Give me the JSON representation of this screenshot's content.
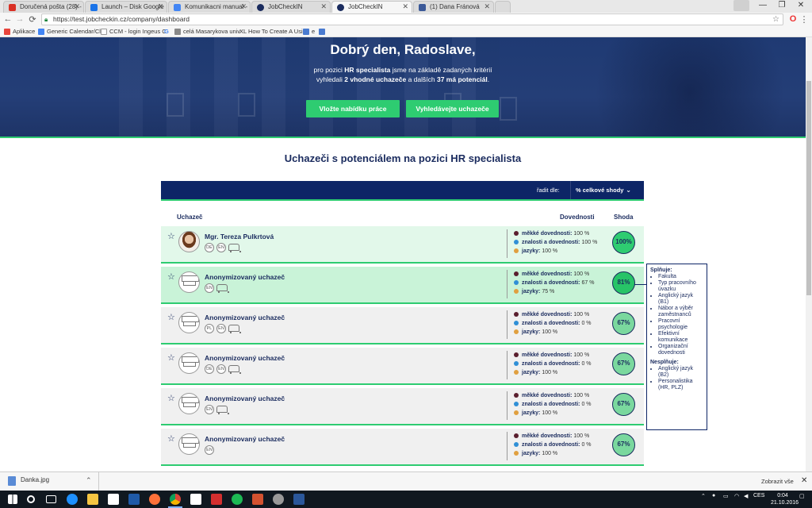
{
  "browser": {
    "tabs": [
      {
        "label": "Doručená pošta (28) - r…",
        "color": "#d93025"
      },
      {
        "label": "Launch – Disk Google",
        "color": "#1a73e8"
      },
      {
        "label": "Komunikacni manual - D…",
        "color": "#4285f4"
      },
      {
        "label": "JobCheckIN",
        "color": "#1a2b5e"
      },
      {
        "label": "JobCheckIN",
        "color": "#1a2b5e"
      },
      {
        "label": "(1) Dana Fránová",
        "color": "#3b5998"
      }
    ],
    "url": "https://test.jobcheckin.cz/company/dashboard",
    "bookmarks": [
      {
        "label": "Aplikace",
        "color": "#e8453c"
      },
      {
        "label": "Generic Calendar/Clo",
        "color": "#4285f4"
      },
      {
        "label": "CCM - login Ingeus C",
        "color": "#555555"
      },
      {
        "label": "G",
        "color": "#4285f4"
      },
      {
        "label": "celá Masarykova univ",
        "color": "#888888"
      },
      {
        "label": "XL How To Create A Usi",
        "color": "#c0392b"
      },
      {
        "label": "e",
        "color": "#4a7bd0"
      },
      {
        "label": "",
        "color": "#4a7bd0"
      }
    ]
  },
  "hero": {
    "greeting": "Dobrý den, Radoslave,",
    "sub1_pre": "pro pozici ",
    "sub1_bold": "HR specialista",
    "sub1_post": " jsme na základě zadaných kritérií",
    "sub2_pre": "vyhledali ",
    "sub2_bold1": "2 vhodné uchazeče",
    "sub2_mid": " a dalších ",
    "sub2_bold2": "37 má potenciál",
    "sub2_post": ".",
    "btn_offer": "Vložte nabídku práce",
    "btn_search": "Vyhledávejte uchazeče"
  },
  "section": {
    "title": "Uchazeči s potenciálem na pozici HR specialista",
    "sort_label": "řadit dle:",
    "sort_value": "% celkové shody",
    "col_candidate": "Uchazeč",
    "col_skills": "Dovednosti",
    "col_match": "Shoda"
  },
  "skill_labels": {
    "soft": "měkké dovednosti:",
    "knowledge": "znalosti a dovednosti:",
    "languages": "jazyky:"
  },
  "colors": {
    "soft": "#5a1f2e",
    "knowledge": "#2f8fd6",
    "languages": "#e0a040",
    "green": "#2ecc71",
    "navy": "#0d2566"
  },
  "candidates": [
    {
      "name": "Mgr. Tereza Pulkrtová",
      "badges": [
        "DE",
        "EN"
      ],
      "car": true,
      "soft": "100 %",
      "knowledge": "100 %",
      "languages": "100 %",
      "score": "100%",
      "bg": "#e2f8ea",
      "score_bg": "#2ecc71"
    },
    {
      "name": "Anonymizovaný uchazeč",
      "badges": [
        "EN"
      ],
      "car": true,
      "soft": "100 %",
      "knowledge": "67 %",
      "languages": "75 %",
      "score": "81%",
      "bg": "#c9f3d8",
      "score_bg": "#27c467"
    },
    {
      "name": "Anonymizovaný uchazeč",
      "badges": [
        "PL",
        "EN"
      ],
      "car": true,
      "soft": "100 %",
      "knowledge": "0 %",
      "languages": "100 %",
      "score": "67%",
      "bg": "#f0f0f0",
      "score_bg": "#7ad89e"
    },
    {
      "name": "Anonymizovaný uchazeč",
      "badges": [
        "DE",
        "EN"
      ],
      "car": true,
      "soft": "100 %",
      "knowledge": "0 %",
      "languages": "100 %",
      "score": "67%",
      "bg": "#f0f0f0",
      "score_bg": "#7ad89e"
    },
    {
      "name": "Anonymizovaný uchazeč",
      "badges": [
        "EN"
      ],
      "car": true,
      "soft": "100 %",
      "knowledge": "0 %",
      "languages": "100 %",
      "score": "67%",
      "bg": "#f0f0f0",
      "score_bg": "#7ad89e"
    },
    {
      "name": "Anonymizovaný uchazeč",
      "badges": [
        "EN"
      ],
      "car": false,
      "soft": "100 %",
      "knowledge": "0 %",
      "languages": "100 %",
      "score": "67%",
      "bg": "#f0f0f0",
      "score_bg": "#7ad89e"
    }
  ],
  "tooltip": {
    "meets_title": "Splňuje:",
    "meets": [
      "Fakulta",
      "Typ pracovního úvazku",
      "Anglický jazyk (B1)",
      "Nábor a výběr zaměstnanců",
      "Pracovní psychologie",
      "Efektivní komunikace",
      "Organizační dovednosti"
    ],
    "fails_title": "Nesplňuje:",
    "fails": [
      "Anglický jazyk (B2)",
      "Personalistika (HR, PLZ)"
    ]
  },
  "downloads": {
    "file": "Danka.jpg",
    "show_all": "Zobrazit vše"
  },
  "taskbar": {
    "lang": "CES",
    "time": "0:04",
    "date": "21.10.2016"
  }
}
